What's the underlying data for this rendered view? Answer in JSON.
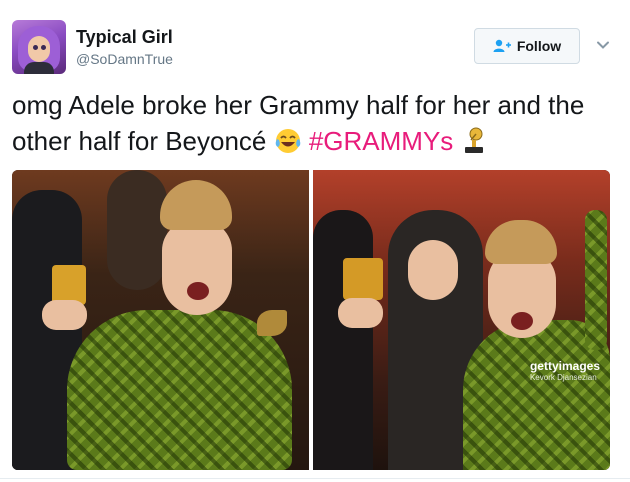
{
  "author": {
    "display_name": "Typical Girl",
    "handle": "@SoDamnTrue"
  },
  "follow_button": {
    "label": "Follow"
  },
  "tweet": {
    "text_main": "omg Adele broke her Grammy half for her and the other half for Beyoncé ",
    "hashtag": "#GRAMMYs",
    "emojis": [
      "face-with-tears-of-joy",
      "grammy-trophy"
    ]
  },
  "media": {
    "watermark_brand": "gettyimages",
    "watermark_credit": "Kevork Djansezian"
  },
  "colors": {
    "hashtag": "#e81c7b",
    "text": "#14171a",
    "secondary": "#657786",
    "dress": "#5b7a1a"
  }
}
